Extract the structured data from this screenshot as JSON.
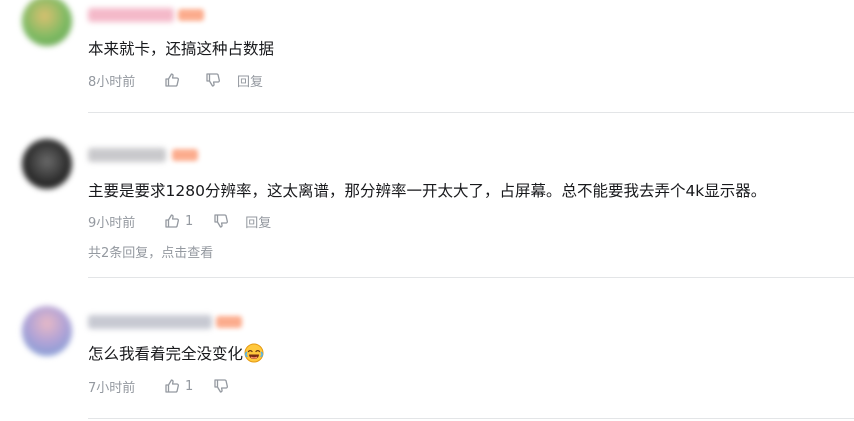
{
  "comments": [
    {
      "text": "本来就卡，还搞这种占数据",
      "time": "8小时前",
      "likes": "",
      "reply_label": "回复",
      "avatar_color": "#8fbf6a"
    },
    {
      "text": "主要是要求1280分辨率，这太离谱，那分辨率一开太大了，占屏幕。总不能要我去弄个4k显示器。",
      "time": "9小时前",
      "likes": "1",
      "reply_label": "回复",
      "replies_label": "共2条回复，点击查看",
      "avatar_color": "#3a3a3a"
    },
    {
      "text": "怎么我看着完全没变化",
      "emoji": "laughing-crying-emoji",
      "time": "7小时前",
      "likes": "1",
      "reply_label": "",
      "avatar_color": "#7aa6d8"
    }
  ],
  "colors": {
    "text": "#18191c",
    "meta": "#9499a0",
    "divider": "#e3e5e7",
    "level_badge": "#fb9e7a"
  }
}
